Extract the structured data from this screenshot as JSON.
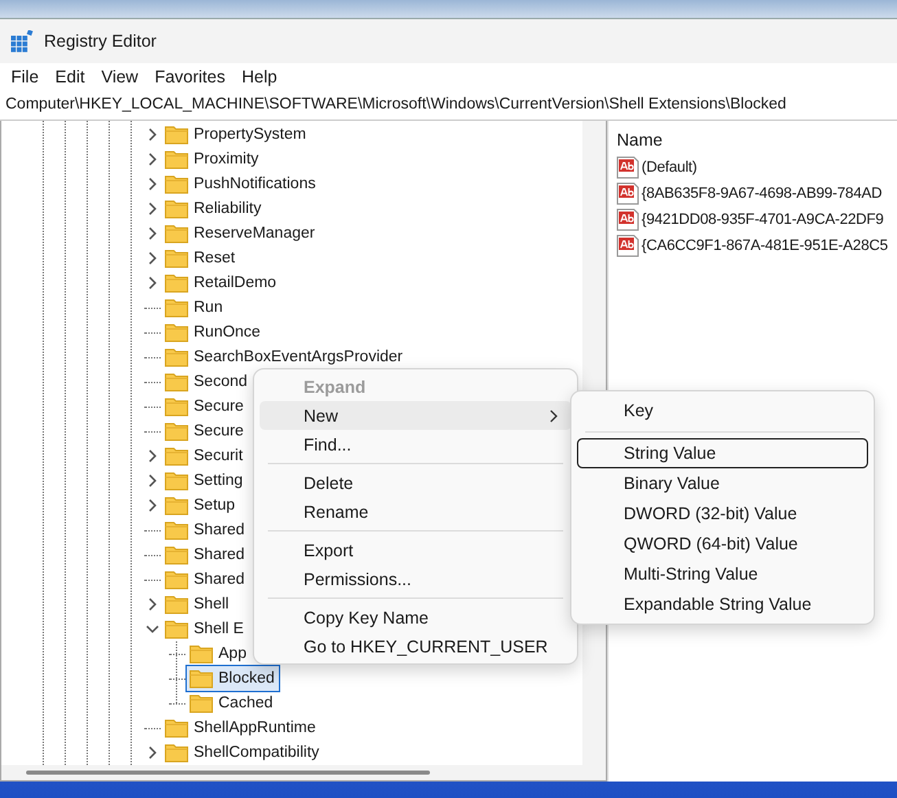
{
  "window": {
    "title": "Registry Editor"
  },
  "menu_bar": [
    "File",
    "Edit",
    "View",
    "Favorites",
    "Help"
  ],
  "address_bar": {
    "value": "Computer\\HKEY_LOCAL_MACHINE\\SOFTWARE\\Microsoft\\Windows\\CurrentVersion\\Shell Extensions\\Blocked"
  },
  "tree": {
    "items": [
      {
        "label": "PropertySystem",
        "expandable": true,
        "expanded": false,
        "selected": false
      },
      {
        "label": "Proximity",
        "expandable": true,
        "expanded": false,
        "selected": false
      },
      {
        "label": "PushNotifications",
        "expandable": true,
        "expanded": false,
        "selected": false
      },
      {
        "label": "Reliability",
        "expandable": true,
        "expanded": false,
        "selected": false
      },
      {
        "label": "ReserveManager",
        "expandable": true,
        "expanded": false,
        "selected": false
      },
      {
        "label": "Reset",
        "expandable": true,
        "expanded": false,
        "selected": false
      },
      {
        "label": "RetailDemo",
        "expandable": true,
        "expanded": false,
        "selected": false
      },
      {
        "label": "Run",
        "expandable": false,
        "expanded": false,
        "selected": false
      },
      {
        "label": "RunOnce",
        "expandable": false,
        "expanded": false,
        "selected": false
      },
      {
        "label": "SearchBoxEventArgsProvider",
        "expandable": false,
        "expanded": false,
        "selected": false
      },
      {
        "label": "Second",
        "expandable": false,
        "expanded": false,
        "selected": false
      },
      {
        "label": "Secure",
        "expandable": false,
        "expanded": false,
        "selected": false
      },
      {
        "label": "Secure",
        "expandable": false,
        "expanded": false,
        "selected": false
      },
      {
        "label": "Securit",
        "expandable": true,
        "expanded": false,
        "selected": false
      },
      {
        "label": "Setting",
        "expandable": true,
        "expanded": false,
        "selected": false
      },
      {
        "label": "Setup",
        "expandable": true,
        "expanded": false,
        "selected": false
      },
      {
        "label": "Shared",
        "expandable": false,
        "expanded": false,
        "selected": false
      },
      {
        "label": "Shared",
        "expandable": false,
        "expanded": false,
        "selected": false
      },
      {
        "label": "Shared",
        "expandable": false,
        "expanded": false,
        "selected": false
      },
      {
        "label": "Shell",
        "expandable": true,
        "expanded": false,
        "selected": false
      },
      {
        "label": "Shell E",
        "expandable": true,
        "expanded": true,
        "selected": false,
        "children": [
          {
            "label": "App",
            "expandable": false,
            "expanded": false,
            "selected": false
          },
          {
            "label": "Blocked",
            "expandable": false,
            "expanded": false,
            "selected": true
          },
          {
            "label": "Cached",
            "expandable": false,
            "expanded": false,
            "selected": false
          }
        ]
      },
      {
        "label": "ShellAppRuntime",
        "expandable": false,
        "expanded": false,
        "selected": false
      },
      {
        "label": "ShellCompatibility",
        "expandable": true,
        "expanded": false,
        "selected": false
      }
    ]
  },
  "values_pane": {
    "columns": [
      "Name"
    ],
    "rows": [
      {
        "name": "(Default)"
      },
      {
        "name": "{8AB635F8-9A67-4698-AB99-784AD"
      },
      {
        "name": "{9421DD08-935F-4701-A9CA-22DF9"
      },
      {
        "name": "{CA6CC9F1-867A-481E-951E-A28C5"
      }
    ]
  },
  "context_menu": {
    "items": [
      {
        "kind": "item",
        "label": "Expand",
        "disabled": true,
        "default": true,
        "highlighted": false,
        "submenu": false
      },
      {
        "kind": "item",
        "label": "New",
        "disabled": false,
        "default": false,
        "highlighted": true,
        "submenu": true
      },
      {
        "kind": "item",
        "label": "Find...",
        "disabled": false,
        "default": false,
        "highlighted": false,
        "submenu": false
      },
      {
        "kind": "separator"
      },
      {
        "kind": "item",
        "label": "Delete",
        "disabled": false,
        "default": false,
        "highlighted": false,
        "submenu": false
      },
      {
        "kind": "item",
        "label": "Rename",
        "disabled": false,
        "default": false,
        "highlighted": false,
        "submenu": false
      },
      {
        "kind": "separator"
      },
      {
        "kind": "item",
        "label": "Export",
        "disabled": false,
        "default": false,
        "highlighted": false,
        "submenu": false
      },
      {
        "kind": "item",
        "label": "Permissions...",
        "disabled": false,
        "default": false,
        "highlighted": false,
        "submenu": false
      },
      {
        "kind": "separator"
      },
      {
        "kind": "item",
        "label": "Copy Key Name",
        "disabled": false,
        "default": false,
        "highlighted": false,
        "submenu": false
      },
      {
        "kind": "item",
        "label": "Go to HKEY_CURRENT_USER",
        "disabled": false,
        "default": false,
        "highlighted": false,
        "submenu": false
      }
    ]
  },
  "submenu": {
    "items": [
      {
        "kind": "item",
        "label": "Key",
        "focused": false
      },
      {
        "kind": "separator"
      },
      {
        "kind": "item",
        "label": "String Value",
        "focused": true
      },
      {
        "kind": "item",
        "label": "Binary Value",
        "focused": false
      },
      {
        "kind": "item",
        "label": "DWORD (32-bit) Value",
        "focused": false
      },
      {
        "kind": "item",
        "label": "QWORD (64-bit) Value",
        "focused": false
      },
      {
        "kind": "item",
        "label": "Multi-String Value",
        "focused": false
      },
      {
        "kind": "item",
        "label": "Expandable String Value",
        "focused": false
      }
    ]
  }
}
